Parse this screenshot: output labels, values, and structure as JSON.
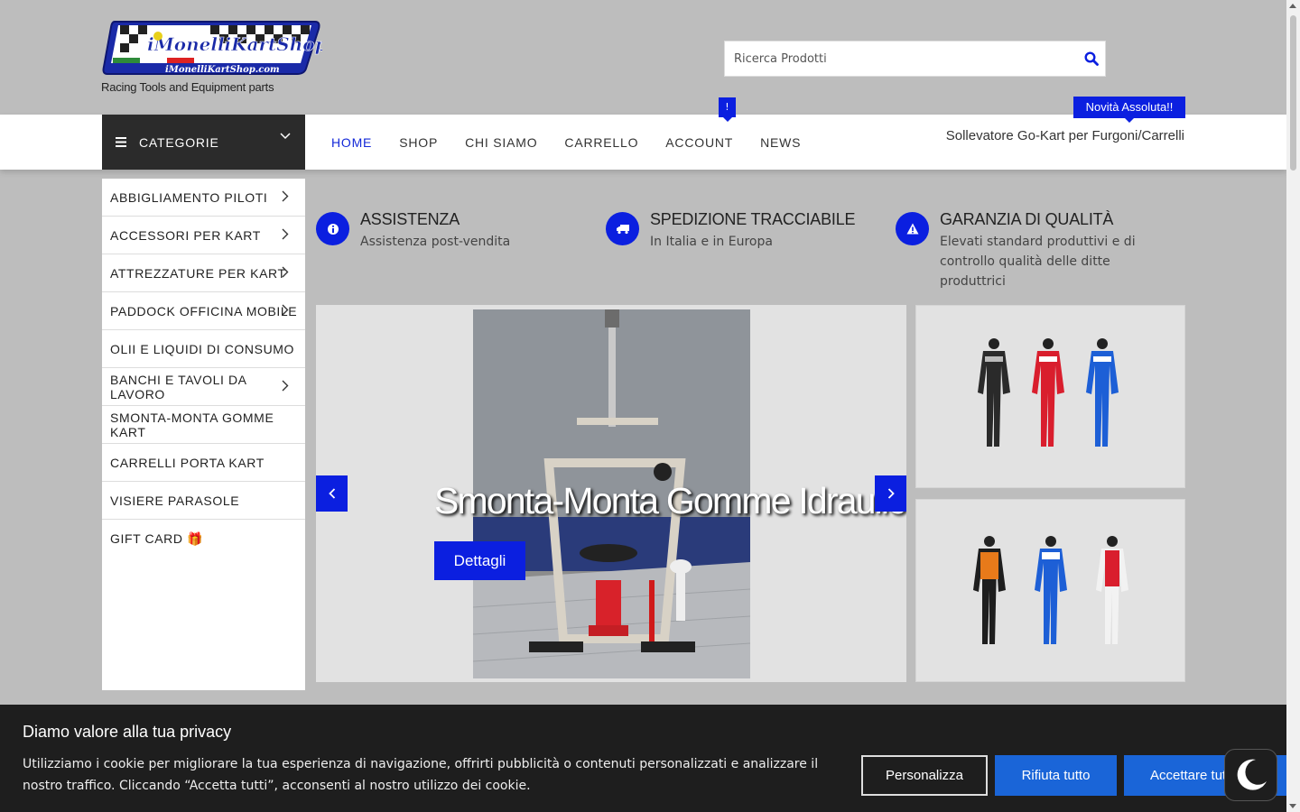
{
  "brand": {
    "tagline": "Racing Tools and Equipment parts",
    "accent": "#0b1fe0"
  },
  "search": {
    "placeholder": "Ricerca Prodotti"
  },
  "nav": {
    "categories_label": "CATEGORIE",
    "items": [
      "HOME",
      "SHOP",
      "CHI SIAMO",
      "CARRELLO",
      "ACCOUNT",
      "NEWS"
    ],
    "news_badge": "!",
    "promo_badge": "Novità Assoluta!!",
    "promo_text": "Sollevatore Go-Kart per Furgoni/Carrelli"
  },
  "sidebar": {
    "items": [
      "ABBIGLIAMENTO PILOTI",
      "ACCESSORI PER KART",
      "ATTREZZATURE PER KART",
      "PADDOCK OFFICINA MOBILE",
      "OLII E LIQUIDI DI CONSUMO",
      "BANCHI E TAVOLI DA LAVORO",
      "SMONTA-MONTA GOMME KART",
      "CARRELLI PORTA KART",
      "VISIERE PARASOLE",
      "GIFT CARD 🎁"
    ]
  },
  "features": [
    {
      "title": "ASSISTENZA",
      "text": "Assistenza post-vendita",
      "icon": "info-icon"
    },
    {
      "title": "SPEDIZIONE TRACCIABILE",
      "text": "In Italia e in Europa",
      "icon": "truck-icon"
    },
    {
      "title": "GARANZIA DI QUALITÀ",
      "text": "Elevati standard produttivi e di controllo qualità delle ditte produttrici",
      "icon": "warning-icon"
    }
  ],
  "slider": {
    "title": "Smonta-Monta Gomme Idraulico",
    "button": "Dettagli"
  },
  "cookie": {
    "title": "Diamo valore alla tua privacy",
    "text": "Utilizziamo i cookie per migliorare la tua esperienza di navigazione, offrirti pubblicità o contenuti personalizzati e analizzare il nostro traffico. Cliccando “Accetta tutti”, acconsenti al nostro utilizzo dei cookie.",
    "customize": "Personalizza",
    "reject": "Rifiuta tutto",
    "accept": "Accettare tutto"
  }
}
